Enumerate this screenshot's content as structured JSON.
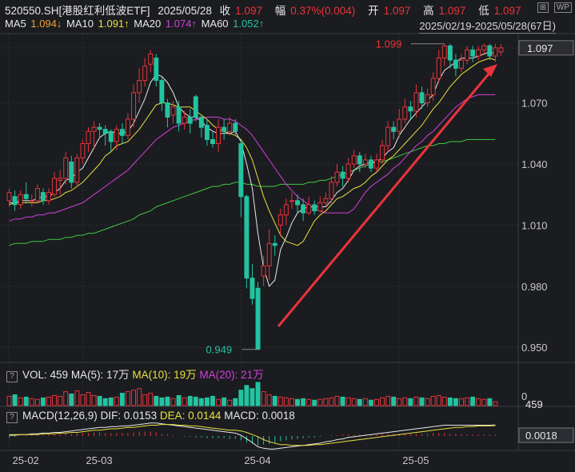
{
  "header": {
    "code": "520550.SH[港股红利低波ETF]",
    "date": "2025/05/28",
    "close_label": "收",
    "close": "1.097",
    "change_label": "幅",
    "change": "0.37%(0.004)",
    "open_label": "开",
    "open": "1.097",
    "high_label": "高",
    "high": "1.097",
    "low_label": "低",
    "low": "1.097"
  },
  "ma_row": {
    "ma5_label": "MA5",
    "ma5": "1.094↓",
    "ma10_label": "MA10",
    "ma10": "1.091↑",
    "ma20_label": "MA20",
    "ma20": "1.074↑",
    "ma60_label": "MA60",
    "ma60": "1.052↑"
  },
  "range": "2025/02/19-2025/05/28(67日)",
  "toolbar": {
    "icon1": "⊞",
    "icon2": "WP"
  },
  "volume_panel": {
    "qmark": "?",
    "label": "VOL: 459",
    "ma5": "MA(5): 17万",
    "ma10": "MA(10): 19万",
    "ma20": "MA(20): 21万",
    "axis_top": "0",
    "axis_value": "459"
  },
  "macd_panel": {
    "qmark": "?",
    "label": "MACD(12,26,9)",
    "dif": "DIF: 0.0153",
    "dea": "DEA: 0.0144",
    "macd": "MACD: 0.0018",
    "axis_value": "0.0018"
  },
  "colors": {
    "up": "#e8343a",
    "down": "#23c3a0",
    "ma5": "#e8e8e8",
    "ma10": "#e8e040",
    "ma20": "#d040d8",
    "ma60": "#40c840",
    "grid": "#2e3036"
  },
  "chart_data": {
    "type": "candlestick",
    "y_ticks": [
      "0.950",
      "0.980",
      "1.010",
      "1.040",
      "1.070",
      "1.097"
    ],
    "ylim": [
      0.943,
      1.104
    ],
    "x_ticks": [
      "25-02",
      "25-03",
      "25-04",
      "25-05"
    ],
    "x_tick_index": [
      0,
      13,
      41,
      69
    ],
    "current_price_label": "1.097",
    "high_marker": "1.099",
    "low_marker": "0.949",
    "candles": [
      [
        1.022,
        1.026,
        1.019,
        1.028
      ],
      [
        1.024,
        1.02,
        1.017,
        1.027
      ],
      [
        1.02,
        1.025,
        1.018,
        1.027
      ],
      [
        1.025,
        1.023,
        1.021,
        1.031
      ],
      [
        1.022,
        1.022,
        1.019,
        1.025
      ],
      [
        1.022,
        1.028,
        1.021,
        1.03
      ],
      [
        1.026,
        1.022,
        1.02,
        1.028
      ],
      [
        1.022,
        1.026,
        1.02,
        1.028
      ],
      [
        1.025,
        1.033,
        1.024,
        1.036
      ],
      [
        1.032,
        1.033,
        1.025,
        1.037
      ],
      [
        1.033,
        1.043,
        1.03,
        1.046
      ],
      [
        1.041,
        1.031,
        1.028,
        1.044
      ],
      [
        1.031,
        1.043,
        1.029,
        1.045
      ],
      [
        1.043,
        1.05,
        1.04,
        1.052
      ],
      [
        1.05,
        1.056,
        1.046,
        1.058
      ],
      [
        1.056,
        1.058,
        1.048,
        1.061
      ],
      [
        1.058,
        1.057,
        1.053,
        1.06
      ],
      [
        1.057,
        1.055,
        1.049,
        1.059
      ],
      [
        1.056,
        1.051,
        1.046,
        1.057
      ],
      [
        1.051,
        1.057,
        1.047,
        1.059
      ],
      [
        1.057,
        1.054,
        1.05,
        1.06
      ],
      [
        1.054,
        1.062,
        1.052,
        1.065
      ],
      [
        1.062,
        1.075,
        1.058,
        1.079
      ],
      [
        1.075,
        1.081,
        1.07,
        1.087
      ],
      [
        1.081,
        1.088,
        1.078,
        1.092
      ],
      [
        1.089,
        1.094,
        1.085,
        1.096
      ],
      [
        1.092,
        1.081,
        1.078,
        1.094
      ],
      [
        1.081,
        1.07,
        1.066,
        1.083
      ],
      [
        1.07,
        1.063,
        1.058,
        1.072
      ],
      [
        1.064,
        1.068,
        1.06,
        1.071
      ],
      [
        1.068,
        1.06,
        1.056,
        1.071
      ],
      [
        1.06,
        1.063,
        1.057,
        1.066
      ],
      [
        1.063,
        1.06,
        1.055,
        1.067
      ],
      [
        1.073,
        1.063,
        1.061,
        1.074
      ],
      [
        1.063,
        1.058,
        1.053,
        1.064
      ],
      [
        1.059,
        1.052,
        1.049,
        1.062
      ],
      [
        1.052,
        1.05,
        1.048,
        1.056
      ],
      [
        1.05,
        1.058,
        1.046,
        1.062
      ],
      [
        1.058,
        1.056,
        1.052,
        1.062
      ],
      [
        1.056,
        1.06,
        1.054,
        1.063
      ],
      [
        1.06,
        1.056,
        1.054,
        1.062
      ],
      [
        1.05,
        1.024,
        1.014,
        1.052
      ],
      [
        1.024,
        0.984,
        0.979,
        1.025
      ],
      [
        0.984,
        0.974,
        0.971,
        0.991
      ],
      [
        0.979,
        0.949,
        0.949,
        0.982
      ],
      [
        0.985,
        0.99,
        0.98,
        0.995
      ],
      [
        0.99,
        1.001,
        0.983,
        1.008
      ],
      [
        1.001,
        1.0,
        0.995,
        1.005
      ],
      [
        1.01,
        1.015,
        1.005,
        1.018
      ],
      [
        1.015,
        1.02,
        1.01,
        1.023
      ],
      [
        1.022,
        1.022,
        1.018,
        1.026
      ],
      [
        1.022,
        1.02,
        1.016,
        1.025
      ],
      [
        1.02,
        1.016,
        1.012,
        1.023
      ],
      [
        1.016,
        1.02,
        1.015,
        1.024
      ],
      [
        1.02,
        1.017,
        1.015,
        1.022
      ],
      [
        1.017,
        1.021,
        1.016,
        1.024
      ],
      [
        1.021,
        1.023,
        1.019,
        1.026
      ],
      [
        1.023,
        1.031,
        1.021,
        1.034
      ],
      [
        1.031,
        1.036,
        1.029,
        1.04
      ],
      [
        1.036,
        1.033,
        1.029,
        1.039
      ],
      [
        1.033,
        1.04,
        1.031,
        1.043
      ],
      [
        1.04,
        1.044,
        1.038,
        1.047
      ],
      [
        1.044,
        1.04,
        1.036,
        1.046
      ],
      [
        1.04,
        1.042,
        1.038,
        1.045
      ],
      [
        1.042,
        1.038,
        1.036,
        1.044
      ],
      [
        1.038,
        1.042,
        1.036,
        1.045
      ],
      [
        1.042,
        1.049,
        1.04,
        1.052
      ],
      [
        1.049,
        1.058,
        1.046,
        1.061
      ],
      [
        1.058,
        1.056,
        1.052,
        1.061
      ],
      [
        1.056,
        1.062,
        1.053,
        1.067
      ],
      [
        1.062,
        1.068,
        1.06,
        1.072
      ],
      [
        1.068,
        1.066,
        1.062,
        1.071
      ],
      [
        1.066,
        1.075,
        1.063,
        1.079
      ],
      [
        1.075,
        1.07,
        1.067,
        1.078
      ],
      [
        1.07,
        1.074,
        1.068,
        1.077
      ],
      [
        1.074,
        1.082,
        1.071,
        1.085
      ],
      [
        1.082,
        1.092,
        1.08,
        1.096
      ],
      [
        1.092,
        1.098,
        1.088,
        1.099
      ],
      [
        1.098,
        1.091,
        1.087,
        1.099
      ],
      [
        1.091,
        1.087,
        1.083,
        1.094
      ],
      [
        1.087,
        1.091,
        1.085,
        1.094
      ],
      [
        1.091,
        1.096,
        1.089,
        1.098
      ],
      [
        1.096,
        1.093,
        1.09,
        1.098
      ],
      [
        1.093,
        1.096,
        1.091,
        1.098
      ],
      [
        1.096,
        1.098,
        1.094,
        1.099
      ],
      [
        1.098,
        1.093,
        1.091,
        1.099
      ],
      [
        1.093,
        1.097,
        1.09,
        1.099
      ],
      [
        1.095,
        1.097,
        1.093,
        1.099
      ]
    ],
    "ma5": [
      1.021,
      1.021,
      1.022,
      1.022,
      1.022,
      1.023,
      1.024,
      1.024,
      1.026,
      1.028,
      1.032,
      1.033,
      1.036,
      1.038,
      1.043,
      1.048,
      1.053,
      1.055,
      1.056,
      1.055,
      1.055,
      1.056,
      1.06,
      1.066,
      1.072,
      1.08,
      1.084,
      1.083,
      1.08,
      1.075,
      1.068,
      1.065,
      1.063,
      1.063,
      1.061,
      1.058,
      1.056,
      1.055,
      1.055,
      1.055,
      1.056,
      1.051,
      1.04,
      1.028,
      1.006,
      0.989,
      0.98,
      0.983,
      0.998,
      1.004,
      1.011,
      1.016,
      1.018,
      1.019,
      1.019,
      1.019,
      1.019,
      1.022,
      1.026,
      1.028,
      1.032,
      1.037,
      1.039,
      1.04,
      1.041,
      1.041,
      1.043,
      1.046,
      1.048,
      1.054,
      1.058,
      1.062,
      1.065,
      1.068,
      1.071,
      1.074,
      1.081,
      1.086,
      1.088,
      1.09,
      1.092,
      1.092,
      1.092,
      1.093,
      1.094,
      1.095,
      1.094
    ],
    "ma10": [
      1.02,
      1.021,
      1.021,
      1.021,
      1.021,
      1.021,
      1.022,
      1.022,
      1.023,
      1.024,
      1.026,
      1.027,
      1.029,
      1.031,
      1.034,
      1.037,
      1.04,
      1.044,
      1.046,
      1.049,
      1.05,
      1.051,
      1.054,
      1.057,
      1.061,
      1.065,
      1.069,
      1.07,
      1.07,
      1.069,
      1.068,
      1.068,
      1.068,
      1.066,
      1.064,
      1.062,
      1.059,
      1.057,
      1.056,
      1.055,
      1.054,
      1.052,
      1.048,
      1.042,
      1.033,
      1.024,
      1.017,
      1.011,
      1.005,
      1.002,
      1.001,
      1.0,
      1.002,
      1.007,
      1.012,
      1.015,
      1.017,
      1.02,
      1.023,
      1.024,
      1.026,
      1.028,
      1.029,
      1.031,
      1.034,
      1.036,
      1.039,
      1.042,
      1.044,
      1.047,
      1.05,
      1.053,
      1.056,
      1.059,
      1.063,
      1.067,
      1.07,
      1.074,
      1.078,
      1.081,
      1.084,
      1.086,
      1.088,
      1.09,
      1.091,
      1.092,
      1.091
    ],
    "ma20": [
      1.012,
      1.013,
      1.013,
      1.014,
      1.014,
      1.015,
      1.015,
      1.016,
      1.016,
      1.017,
      1.018,
      1.019,
      1.02,
      1.021,
      1.023,
      1.025,
      1.027,
      1.029,
      1.031,
      1.033,
      1.035,
      1.037,
      1.04,
      1.043,
      1.046,
      1.049,
      1.052,
      1.054,
      1.056,
      1.058,
      1.059,
      1.06,
      1.061,
      1.062,
      1.062,
      1.063,
      1.063,
      1.063,
      1.062,
      1.062,
      1.061,
      1.059,
      1.057,
      1.054,
      1.05,
      1.046,
      1.042,
      1.038,
      1.034,
      1.03,
      1.027,
      1.024,
      1.022,
      1.02,
      1.018,
      1.017,
      1.016,
      1.016,
      1.016,
      1.016,
      1.016,
      1.018,
      1.022,
      1.026,
      1.029,
      1.031,
      1.033,
      1.035,
      1.038,
      1.04,
      1.043,
      1.046,
      1.049,
      1.051,
      1.054,
      1.056,
      1.059,
      1.062,
      1.065,
      1.068,
      1.07,
      1.072,
      1.073,
      1.074,
      1.074,
      1.074,
      1.074
    ],
    "ma60": [
      1.0,
      1.001,
      1.001,
      1.001,
      1.002,
      1.002,
      1.002,
      1.003,
      1.003,
      1.003,
      1.004,
      1.004,
      1.005,
      1.005,
      1.006,
      1.006,
      1.007,
      1.008,
      1.009,
      1.01,
      1.011,
      1.012,
      1.013,
      1.015,
      1.016,
      1.017,
      1.019,
      1.02,
      1.021,
      1.022,
      1.023,
      1.024,
      1.025,
      1.026,
      1.027,
      1.028,
      1.029,
      1.029,
      1.03,
      1.03,
      1.031,
      1.031,
      1.03,
      1.03,
      1.029,
      1.029,
      1.029,
      1.029,
      1.03,
      1.03,
      1.03,
      1.03,
      1.03,
      1.031,
      1.031,
      1.032,
      1.032,
      1.033,
      1.034,
      1.035,
      1.036,
      1.037,
      1.038,
      1.039,
      1.04,
      1.041,
      1.041,
      1.042,
      1.043,
      1.044,
      1.045,
      1.046,
      1.047,
      1.048,
      1.049,
      1.049,
      1.05,
      1.05,
      1.051,
      1.051,
      1.051,
      1.052,
      1.052,
      1.052,
      1.052,
      1.052,
      1.052
    ],
    "volume": [
      12,
      14,
      10,
      11,
      9,
      8,
      10,
      11,
      13,
      12,
      18,
      15,
      19,
      14,
      17,
      13,
      12,
      9,
      10,
      11,
      16,
      18,
      20,
      22,
      14,
      16,
      12,
      10,
      11,
      9,
      13,
      10,
      12,
      11,
      9,
      10,
      12,
      8,
      10,
      7,
      9,
      20,
      26,
      22,
      30,
      18,
      14,
      12,
      11,
      10,
      9,
      8,
      9,
      8,
      7,
      8,
      9,
      10,
      12,
      11,
      10,
      9,
      8,
      9,
      7,
      8,
      10,
      12,
      11,
      9,
      10,
      9,
      11,
      10,
      9,
      12,
      13,
      11,
      10,
      9,
      9,
      10,
      11,
      9,
      8,
      9,
      5
    ],
    "macd_hist": [
      -0.002,
      -0.001,
      0.0,
      0.001,
      0.001,
      0.002,
      0.002,
      0.002,
      0.003,
      0.003,
      0.004,
      0.003,
      0.004,
      0.004,
      0.004,
      0.005,
      0.005,
      0.004,
      0.004,
      0.004,
      0.004,
      0.004,
      0.005,
      0.006,
      0.006,
      0.006,
      0.005,
      0.003,
      0.002,
      0.001,
      0.0,
      -0.001,
      -0.001,
      -0.002,
      -0.002,
      -0.003,
      -0.003,
      -0.003,
      -0.003,
      -0.004,
      -0.004,
      -0.006,
      -0.009,
      -0.011,
      -0.013,
      -0.012,
      -0.011,
      -0.009,
      -0.007,
      -0.006,
      -0.005,
      -0.004,
      -0.003,
      -0.002,
      -0.002,
      -0.001,
      0.0,
      0.001,
      0.001,
      0.002,
      0.002,
      0.002,
      0.002,
      0.002,
      0.002,
      0.002,
      0.003,
      0.003,
      0.003,
      0.003,
      0.003,
      0.003,
      0.003,
      0.003,
      0.003,
      0.004,
      0.004,
      0.004,
      0.003,
      0.003,
      0.003,
      0.002,
      0.002,
      0.002,
      0.002,
      0.002,
      0.0018
    ],
    "dif": [
      0.001,
      0.001,
      0.002,
      0.002,
      0.003,
      0.003,
      0.004,
      0.004,
      0.005,
      0.005,
      0.006,
      0.007,
      0.008,
      0.009,
      0.01,
      0.011,
      0.012,
      0.012,
      0.013,
      0.013,
      0.014,
      0.014,
      0.015,
      0.016,
      0.017,
      0.018,
      0.018,
      0.017,
      0.016,
      0.015,
      0.014,
      0.013,
      0.012,
      0.011,
      0.01,
      0.009,
      0.008,
      0.007,
      0.006,
      0.005,
      0.004,
      0.001,
      -0.004,
      -0.009,
      -0.015,
      -0.017,
      -0.018,
      -0.018,
      -0.017,
      -0.016,
      -0.015,
      -0.014,
      -0.013,
      -0.012,
      -0.011,
      -0.01,
      -0.008,
      -0.007,
      -0.005,
      -0.004,
      -0.002,
      -0.001,
      0.0,
      0.001,
      0.002,
      0.003,
      0.004,
      0.005,
      0.006,
      0.007,
      0.008,
      0.009,
      0.01,
      0.011,
      0.012,
      0.013,
      0.014,
      0.015,
      0.015,
      0.015,
      0.015,
      0.015,
      0.015,
      0.015,
      0.015,
      0.015,
      0.0153
    ],
    "dea": [
      0.002,
      0.002,
      0.002,
      0.002,
      0.002,
      0.002,
      0.003,
      0.003,
      0.003,
      0.004,
      0.004,
      0.005,
      0.005,
      0.006,
      0.007,
      0.008,
      0.008,
      0.009,
      0.01,
      0.01,
      0.011,
      0.012,
      0.012,
      0.013,
      0.014,
      0.015,
      0.015,
      0.016,
      0.016,
      0.016,
      0.015,
      0.015,
      0.014,
      0.014,
      0.013,
      0.012,
      0.011,
      0.01,
      0.009,
      0.008,
      0.008,
      0.007,
      0.005,
      0.002,
      -0.001,
      -0.005,
      -0.008,
      -0.01,
      -0.012,
      -0.012,
      -0.013,
      -0.013,
      -0.013,
      -0.013,
      -0.012,
      -0.012,
      -0.011,
      -0.01,
      -0.009,
      -0.008,
      -0.007,
      -0.006,
      -0.005,
      -0.004,
      -0.003,
      -0.002,
      -0.001,
      0.0,
      0.001,
      0.002,
      0.003,
      0.004,
      0.005,
      0.006,
      0.007,
      0.008,
      0.009,
      0.01,
      0.011,
      0.012,
      0.012,
      0.013,
      0.013,
      0.014,
      0.014,
      0.014,
      0.0144
    ]
  }
}
